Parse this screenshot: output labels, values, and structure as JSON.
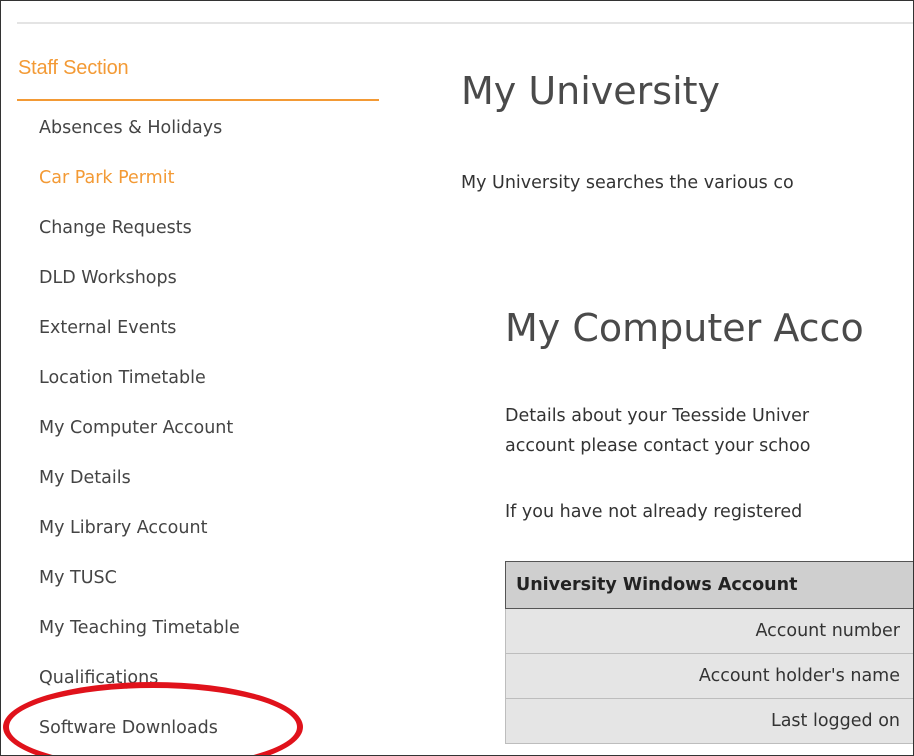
{
  "sidebar": {
    "heading": "Staff Section",
    "items": [
      {
        "label": "Absences & Holidays"
      },
      {
        "label": "Car Park Permit"
      },
      {
        "label": "Change Requests"
      },
      {
        "label": "DLD Workshops"
      },
      {
        "label": "External Events"
      },
      {
        "label": "Location Timetable"
      },
      {
        "label": "My Computer Account"
      },
      {
        "label": "My Details"
      },
      {
        "label": "My Library Account"
      },
      {
        "label": "My TUSC"
      },
      {
        "label": "My Teaching Timetable"
      },
      {
        "label": "Qualifications"
      },
      {
        "label": "Software Downloads"
      }
    ]
  },
  "main": {
    "title": "My University",
    "intro": "My University searches the various co",
    "section_title": "My Computer Acco",
    "details_line1": "Details about your Teesside Univer",
    "details_line2": "account please contact your schoo",
    "register_text": "If you have not already registered",
    "table": {
      "header": "University Windows Account",
      "rows": [
        "Account number",
        "Account holder's name",
        "Last logged on"
      ]
    }
  },
  "colors": {
    "accent_orange": "#f39a35",
    "highlight_red": "#e0121b",
    "table_header_bg": "#cfcfcf",
    "table_row_bg": "#e5e5e5"
  }
}
